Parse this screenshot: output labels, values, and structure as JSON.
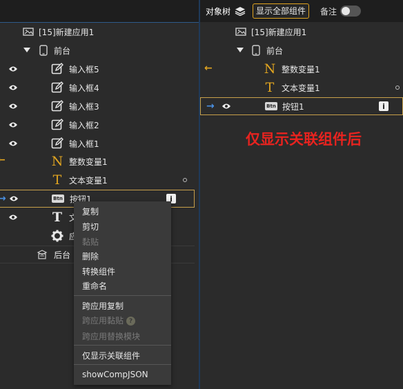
{
  "left_tree": {
    "app_name": "[15]新建应用1",
    "frontend": "前台",
    "items": [
      {
        "label": "输入框5",
        "icon": "edit-icon"
      },
      {
        "label": "输入框4",
        "icon": "edit-icon"
      },
      {
        "label": "输入框3",
        "icon": "edit-icon"
      },
      {
        "label": "输入框2",
        "icon": "edit-icon"
      },
      {
        "label": "输入框1",
        "icon": "edit-icon"
      }
    ],
    "int_var": "整数变量1",
    "text_var": "文本变量1",
    "button": "按钮1",
    "button_badge": "Btn",
    "text_partial": "文",
    "gear_partial": "应",
    "backend": "后台"
  },
  "context_menu": {
    "copy": "复制",
    "cut": "剪切",
    "paste": "黏贴",
    "delete": "删除",
    "convert": "转换组件",
    "rename": "重命名",
    "cross_copy": "跨应用复制",
    "cross_paste": "跨应用黏贴",
    "cross_replace": "跨应用替换模块",
    "show_related": "仅显示关联组件",
    "show_json": "showCompJSON"
  },
  "right_panel": {
    "title": "对象树",
    "show_all_button": "显示全部组件",
    "note_label": "备注",
    "note_toggle_on": false,
    "app_name": "[15]新建应用1",
    "frontend": "前台",
    "int_var": "整数变量1",
    "text_var": "文本变量1",
    "button": "按钮1",
    "button_badge": "Btn"
  },
  "annotation": "仅显示关联组件后",
  "colors": {
    "accent": "#e0a420",
    "annotation": "#e8231f",
    "panel_bg": "#2b2b2b",
    "menu_bg": "#3a3a3a"
  }
}
